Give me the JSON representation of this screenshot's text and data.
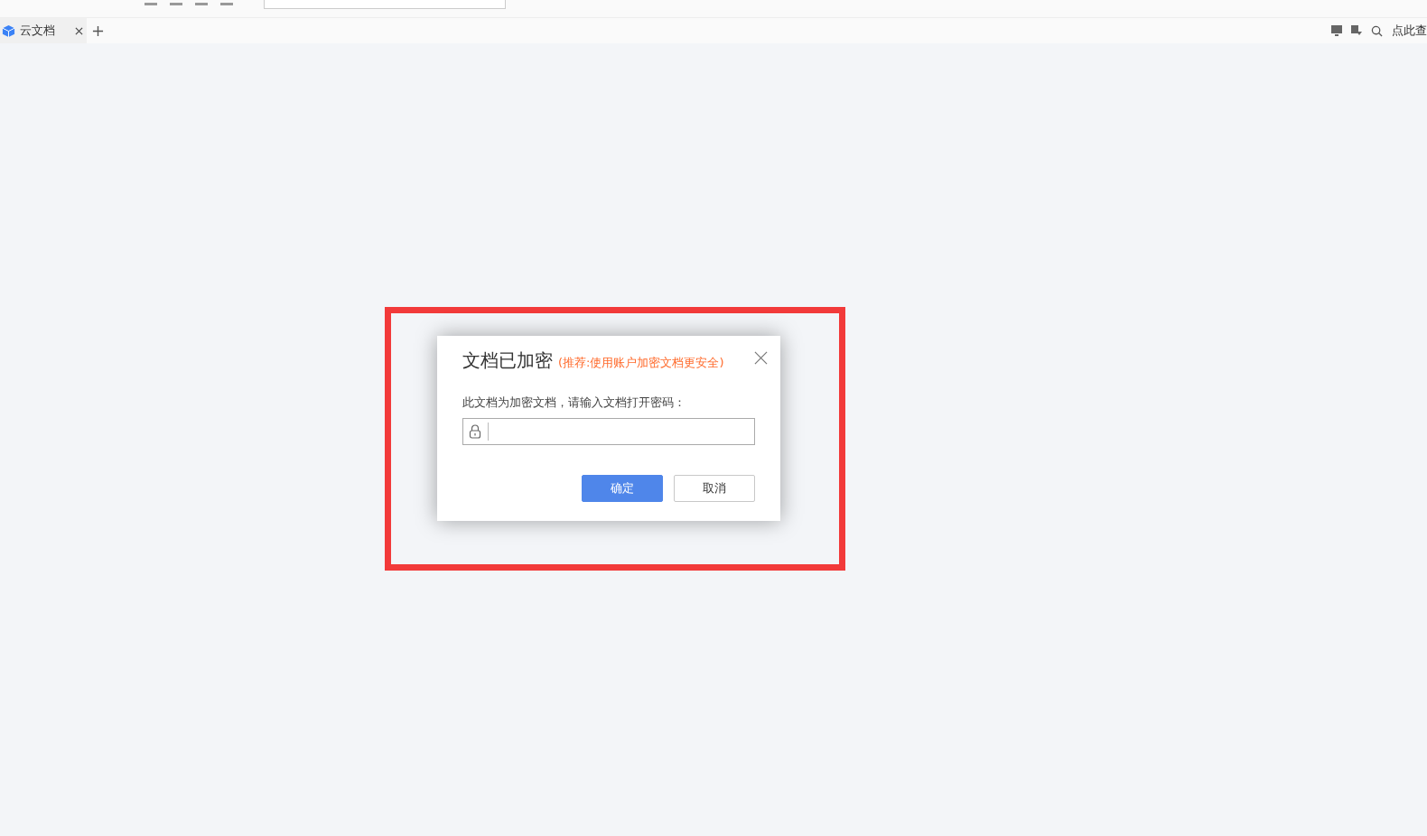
{
  "tabs": [
    {
      "label": "云文档",
      "selected": true
    }
  ],
  "search": {
    "label": "点此查"
  },
  "dialog": {
    "title": "文档已加密",
    "hint": "(推荐:使用账户加密文档更安全)",
    "prompt": "此文档为加密文档，请输入文档打开密码：",
    "buttons": [
      {
        "label": "确定",
        "kind": "primary"
      },
      {
        "label": "取消",
        "kind": "secondary"
      }
    ]
  }
}
